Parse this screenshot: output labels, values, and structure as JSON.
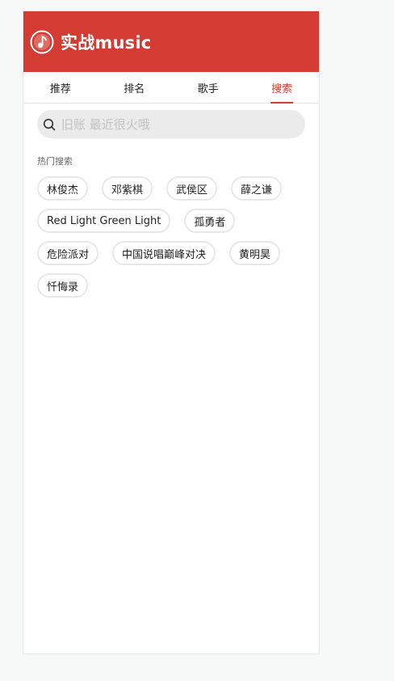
{
  "header": {
    "title": "实战music",
    "logo_icon": "music-note-circle-icon",
    "color": "#d43c33"
  },
  "tabs": [
    {
      "label": "推荐",
      "active": false
    },
    {
      "label": "排名",
      "active": false
    },
    {
      "label": "歌手",
      "active": false
    },
    {
      "label": "搜索",
      "active": true
    }
  ],
  "search": {
    "placeholder": "旧账 最近很火哦",
    "icon": "search-icon"
  },
  "hot": {
    "title": "热门搜索",
    "tags": [
      "林俊杰",
      "邓紫棋",
      "武侯区",
      "薛之谦",
      "Red Light Green Light",
      "孤勇者",
      "危险派对",
      "中国说唱巅峰对决",
      "黄明昊",
      "忏悔录"
    ]
  }
}
